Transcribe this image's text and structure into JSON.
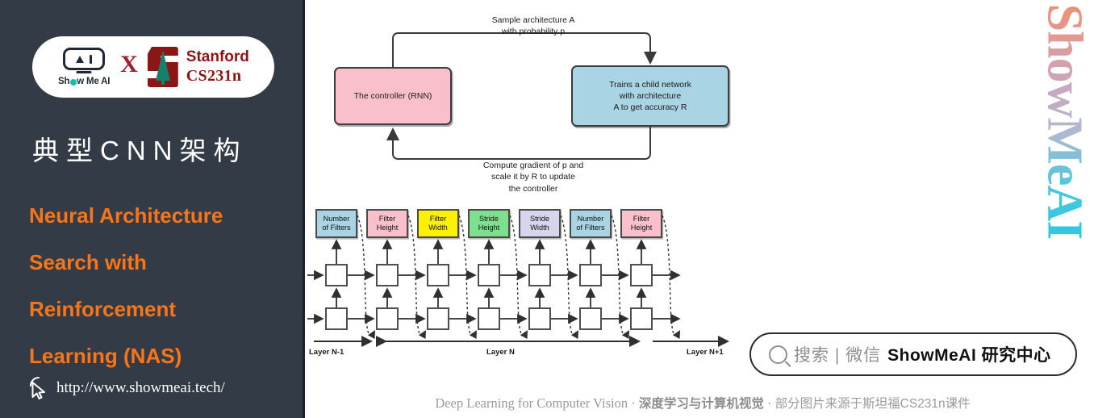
{
  "sidebar": {
    "badge": {
      "brand_name": "Show Me AI",
      "cross": "X",
      "partner_line1": "Stanford",
      "partner_line2": "CS231n",
      "icons": [
        "showmeai-logo-icon",
        "stanford-tree-icon"
      ]
    },
    "chinese_title": "典型CNN架构",
    "subtitle_lines": [
      "Neural Architecture",
      "Search with",
      "Reinforcement",
      "Learning (NAS)"
    ],
    "url": "http://www.showmeai.tech/",
    "cursor_icon": "click-cursor-icon",
    "colors": {
      "background": "#333b47",
      "accent_orange": "#f97518",
      "title_white": "#ffffff"
    }
  },
  "main": {
    "flow_diagram": {
      "top_label": "Sample architecture A\nwith probability p",
      "top_label_line1": "Sample architecture A",
      "top_label_line2": "with probability p",
      "bottom_label_line1": "Compute gradient of p and",
      "bottom_label_line2": "scale it by R to update",
      "bottom_label_line3": "the controller",
      "controller_box": "The controller (RNN)",
      "child_box_line1": "Trains a child network",
      "child_box_line2": "with architecture",
      "child_box_line3": "A to get accuracy R",
      "controller_color": "#f9c0cb",
      "child_color": "#a8d4e4"
    },
    "rnn_diagram": {
      "cells": [
        {
          "line1": "Number",
          "line2": "of Filters",
          "color": "#a8d4e4"
        },
        {
          "line1": "Filter",
          "line2": "Height",
          "color": "#f9c0cb"
        },
        {
          "line1": "Filter",
          "line2": "Width",
          "color": "#fdf000"
        },
        {
          "line1": "Stride",
          "line2": "Height",
          "color": "#7ee08f"
        },
        {
          "line1": "Stride",
          "line2": "Width",
          "color": "#d5d5ee"
        },
        {
          "line1": "Number",
          "line2": "of Filters",
          "color": "#a8d4e4"
        },
        {
          "line1": "Filter",
          "line2": "Height",
          "color": "#f9c0cb"
        }
      ],
      "layer_labels": [
        "Layer N-1",
        "Layer N",
        "Layer N+1"
      ]
    },
    "wechat_pill": {
      "search_icon": "magnifier-icon",
      "grey_text": "搜索 | 微信",
      "bold_text": "ShowMeAI 研究中心"
    },
    "footer": {
      "english": "Deep Learning for Computer Vision",
      "sep1": "·",
      "chinese_bold": "深度学习与计算机视觉",
      "sep2": "·",
      "chinese_light": "部分图片来源于斯坦福CS231n课件"
    },
    "watermark": "ShowMeAI"
  }
}
